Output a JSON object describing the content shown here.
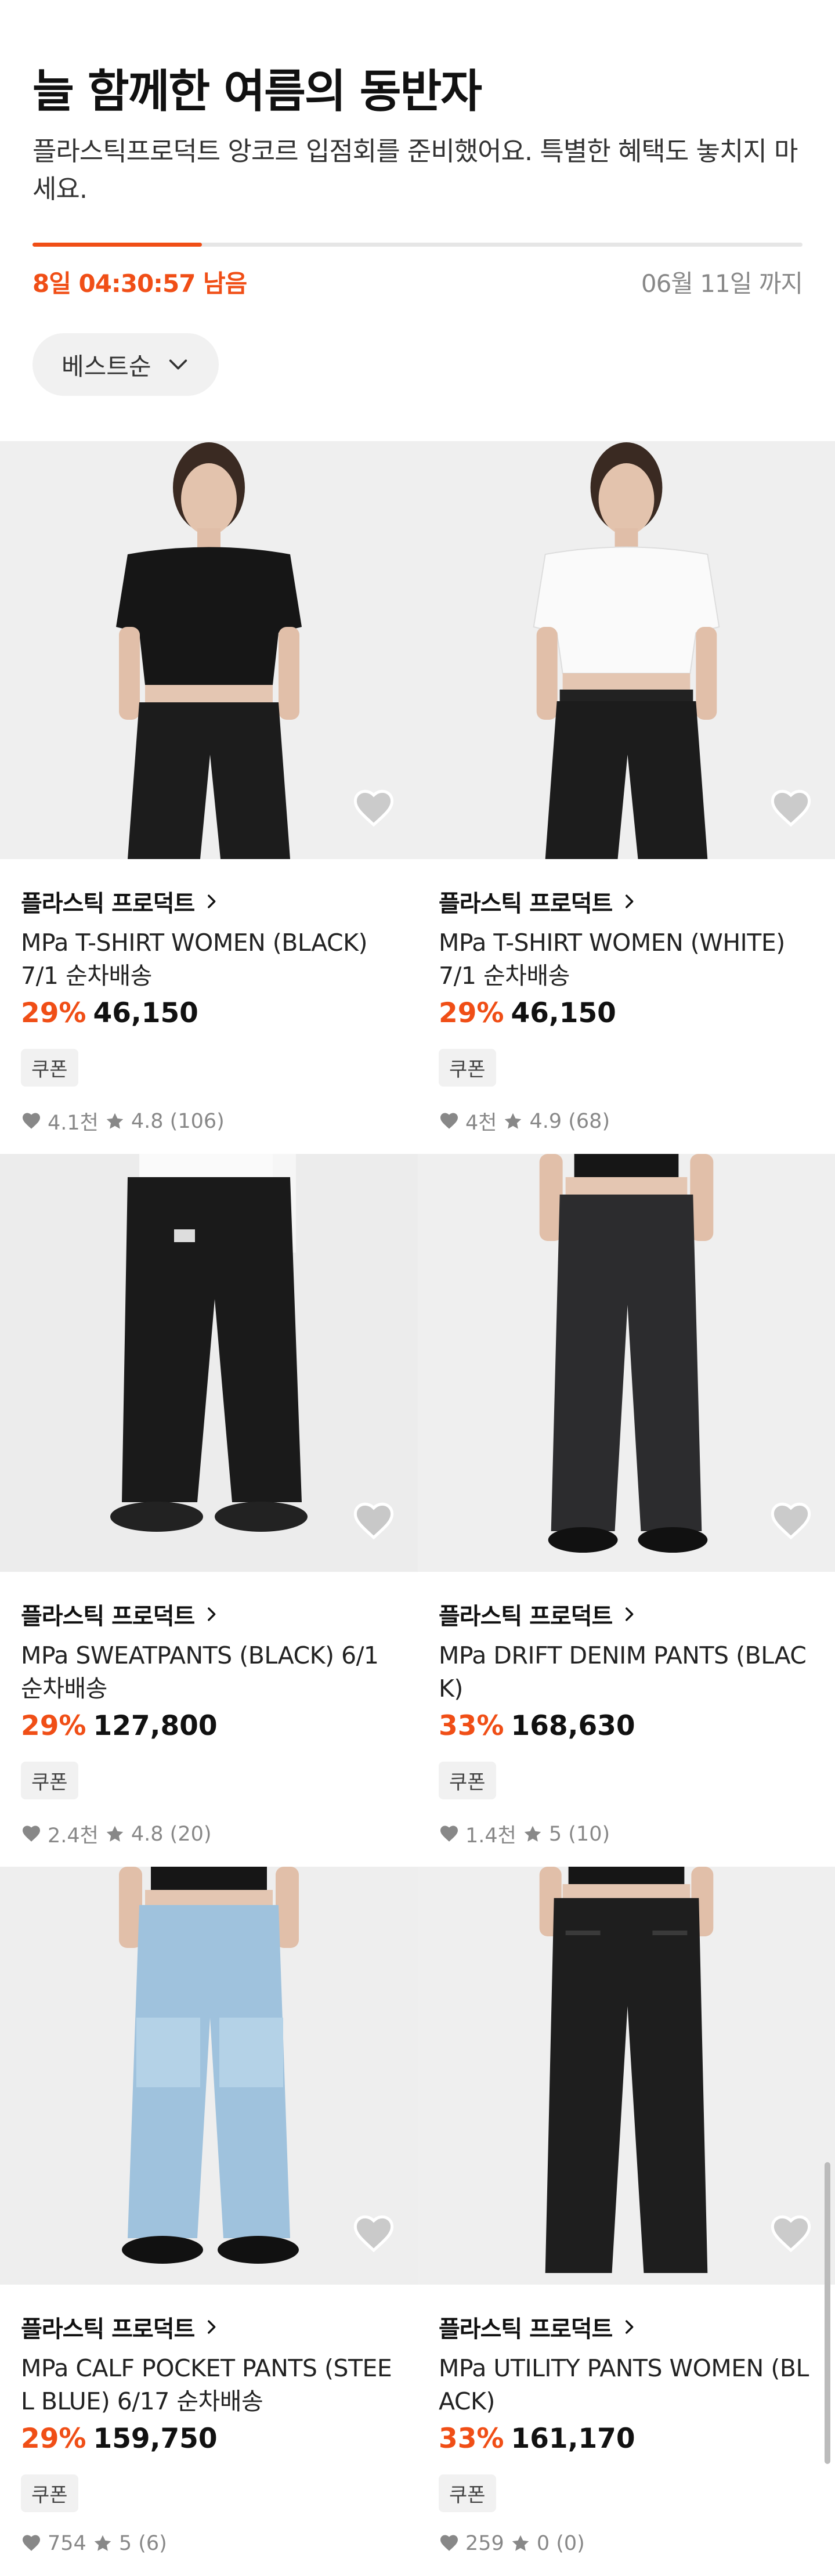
{
  "header": {
    "title": "늘 함께한 여름의 동반자",
    "description": "플라스틱프로덕트 앙코르 입점회를 준비했어요. 특별한 혜택도 놓치지 마세요."
  },
  "progress": {
    "fraction": 0.22
  },
  "timer": {
    "remaining": "8일 04:30:57 남음",
    "end_date": "06월 11일 까지"
  },
  "sort": {
    "label": "베스트순"
  },
  "colors": {
    "accent": "#f04e16",
    "muted": "#888888"
  },
  "products": [
    {
      "brand": "플라스틱 프로덕트",
      "name": "MPa T-SHIRT WOMEN (BLACK) 7/1 순차배송",
      "discount": "29%",
      "price": "46,150",
      "coupon": "쿠폰",
      "likes": "4.1천",
      "rating": "4.8 (106)",
      "image": "black t-shirt and black pants"
    },
    {
      "brand": "플라스틱 프로덕트",
      "name": "MPa T-SHIRT WOMEN (WHITE) 7/1 순차배송",
      "discount": "29%",
      "price": "46,150",
      "coupon": "쿠폰",
      "likes": "4천",
      "rating": "4.9 (68)",
      "image": "white t-shirt and black pants"
    },
    {
      "brand": "플라스틱 프로덕트",
      "name": "MPa SWEATPANTS (BLACK) 6/1 순차배송",
      "discount": "29%",
      "price": "127,800",
      "coupon": "쿠폰",
      "likes": "2.4천",
      "rating": "4.8 (20)",
      "image": "black sweatpants"
    },
    {
      "brand": "플라스틱 프로덕트",
      "name": "MPa DRIFT DENIM PANTS (BLACK)",
      "discount": "33%",
      "price": "168,630",
      "coupon": "쿠폰",
      "likes": "1.4천",
      "rating": "5 (10)",
      "image": "black denim pants"
    },
    {
      "brand": "플라스틱 프로덕트",
      "name": "MPa CALF POCKET PANTS (STEEL BLUE) 6/17 순차배송",
      "discount": "29%",
      "price": "159,750",
      "coupon": "쿠폰",
      "likes": "754",
      "rating": "5 (6)",
      "image": "light blue denim pants"
    },
    {
      "brand": "플라스틱 프로덕트",
      "name": "MPa UTILITY PANTS WOMEN (BLACK)",
      "discount": "33%",
      "price": "161,170",
      "coupon": "쿠폰",
      "likes": "259",
      "rating": "0 (0)",
      "image": "black utility pants"
    }
  ]
}
